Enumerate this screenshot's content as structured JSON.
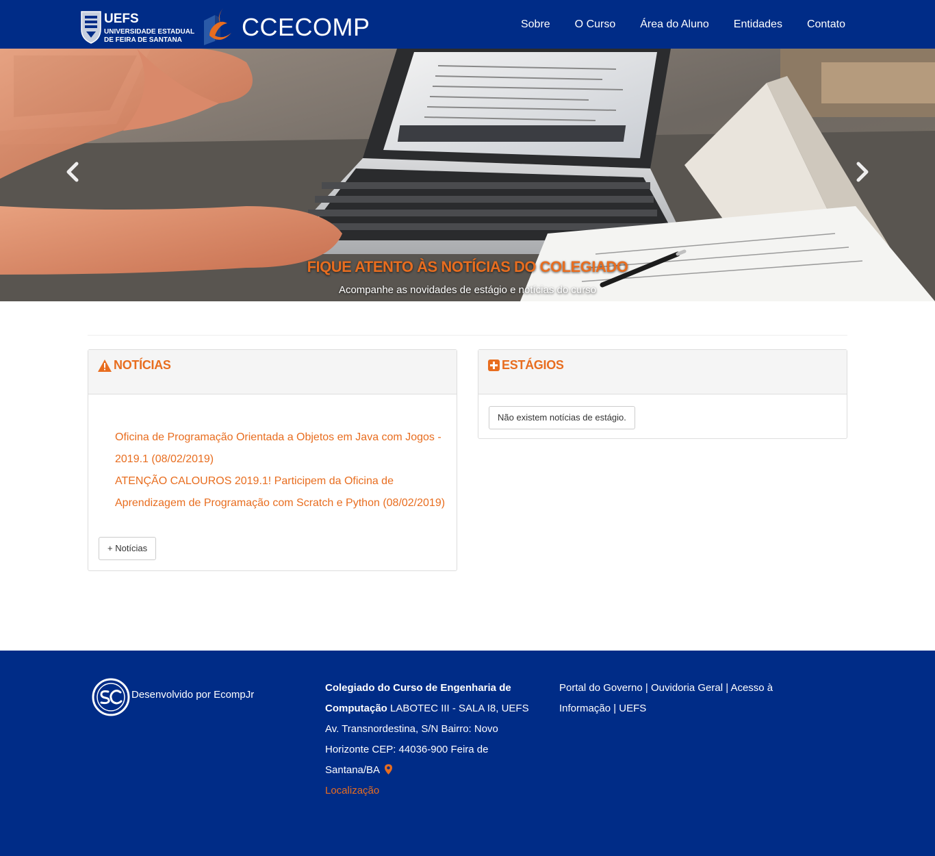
{
  "header": {
    "uefs_word": "UEFS",
    "uefs_line1": "UNIVERSIDADE ESTADUAL",
    "uefs_line2": "DE FEIRA DE SANTANA",
    "brand": "CCECOMP",
    "nav": [
      "Sobre",
      "O Curso",
      "Área do Aluno",
      "Entidades",
      "Contato"
    ]
  },
  "carousel": {
    "title": "FIQUE ATENTO ÀS NOTÍCIAS DO COLEGIADO",
    "subtitle": "Acompanhe as novidades de estágio e notícias do curso",
    "prev_icon": "chevron-left-icon",
    "next_icon": "chevron-right-icon"
  },
  "news": {
    "title": "NOTÍCIAS",
    "icon": "warning-icon",
    "items": [
      "Oficina de Programação Orientada a Objetos em Java com Jogos - 2019.1 (08/02/2019)",
      "ATENÇÃO CALOUROS 2019.1! Participem da Oficina de Aprendizagem de Programação com Scratch e Python (08/02/2019)"
    ],
    "more_button": "+ Notícias"
  },
  "internships": {
    "title": "ESTÁGIOS",
    "icon": "plus-square-icon",
    "empty_message": "Não existem notícias de estágio."
  },
  "footer": {
    "dev_text": "Desenvolvido por EcompJr",
    "address_bold": "Colegiado do Curso de Engenharia de Computação",
    "address_rest": " LABOTEC III - SALA I8, UEFS Av. Transnordestina, S/N Bairro: Novo Horizonte CEP: 44036-900 Feira de Santana/BA",
    "location_link": "Localização",
    "links": [
      "Portal do Governo",
      "Ouvidoria Geral",
      "Acesso à Informação",
      "UEFS"
    ],
    "separator": " | "
  },
  "colors": {
    "navy": "#002c87",
    "accent_orange": "#e86d1f"
  }
}
